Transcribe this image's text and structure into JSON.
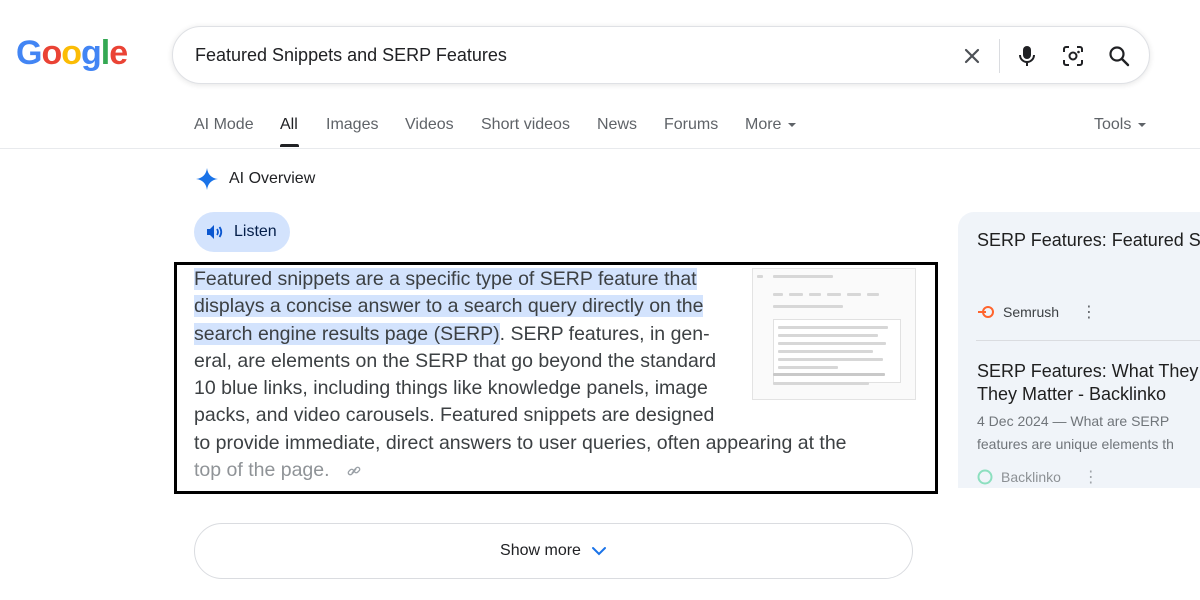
{
  "logo": {
    "letters": [
      "G",
      "o",
      "o",
      "g",
      "l",
      "e"
    ],
    "colors": [
      "#4285F4",
      "#EA4335",
      "#FBBC05",
      "#4285F4",
      "#34A853",
      "#EA4335"
    ]
  },
  "search": {
    "query": "Featured Snippets and SERP Features"
  },
  "tabs": [
    {
      "label": "AI Mode"
    },
    {
      "label": "All",
      "active": true
    },
    {
      "label": "Images"
    },
    {
      "label": "Videos"
    },
    {
      "label": "Short videos"
    },
    {
      "label": "News"
    },
    {
      "label": "Forums"
    },
    {
      "label": "More"
    }
  ],
  "tools_label": "Tools",
  "ai_overview": {
    "title": "AI Overview",
    "listen_label": "Listen",
    "lines": [
      "Featured snippets are a specific type of SERP feature that",
      "displays a concise answer to a search query directly on the",
      "search engine results page (SERP)",
      ". SERP features, in gen-",
      "eral, are elements on the SERP that go beyond the standard",
      "10 blue links, including things like knowledge panels, image",
      "packs, and video carousels. Featured snippets are designed",
      "to provide immediate, direct answers to user queries, often appearing at the",
      "top of the page."
    ],
    "show_more_label": "Show more"
  },
  "side_results": [
    {
      "title": "SERP Features: Featured S",
      "source": "Semrush"
    },
    {
      "title_line1": "SERP Features: What They",
      "title_line2": "They Matter - Backlinko",
      "snippet_line1": "4 Dec 2024 — What are SERP",
      "snippet_line2": "features are unique elements th",
      "source": "Backlinko"
    }
  ],
  "colors": {
    "accent_blue": "#1a73e8",
    "highlight": "#d3e3fd",
    "semrush": "#ff642d",
    "backlinko": "#3ccf91"
  }
}
